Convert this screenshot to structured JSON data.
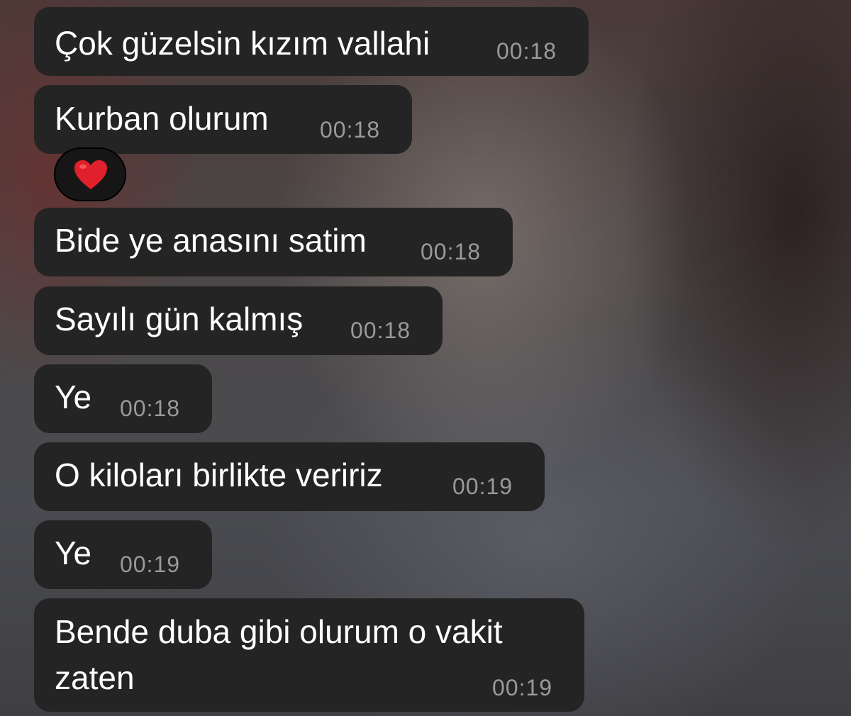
{
  "messages": [
    {
      "text": "Çok güzelsin kızım vallahi",
      "time": "00:18"
    },
    {
      "text": "Kurban olurum",
      "time": "00:18",
      "reaction": "heart-icon"
    },
    {
      "text": "Bide ye anasını satim",
      "time": "00:18"
    },
    {
      "text": "Sayılı gün kalmış",
      "time": "00:18"
    },
    {
      "text": "Ye",
      "time": "00:18"
    },
    {
      "text": "O kiloları birlikte veririz",
      "time": "00:19"
    },
    {
      "text": "Ye",
      "time": "00:19"
    },
    {
      "text_line1": "Bende duba gibi olurum o vakit",
      "text_line2": "zaten",
      "time": "00:19"
    }
  ],
  "colors": {
    "bubble": "#242424",
    "text": "#ffffff",
    "timestamp": "#9a9a9a",
    "heart": "#e0202a"
  }
}
